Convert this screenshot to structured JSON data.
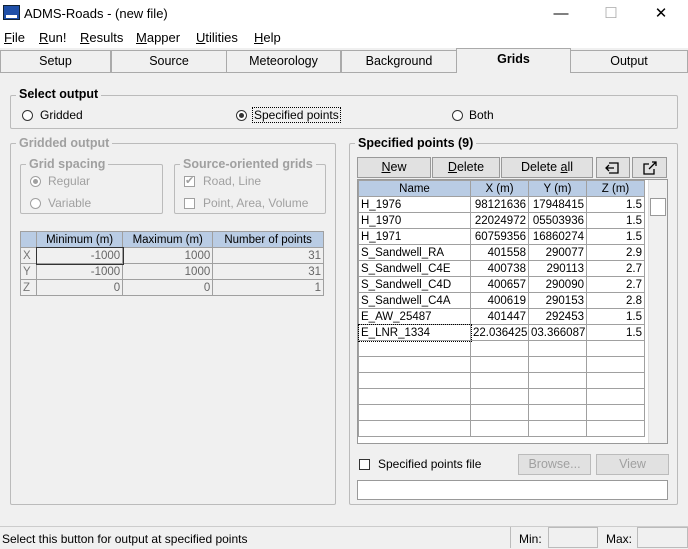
{
  "window": {
    "title": "ADMS-Roads - (new file)",
    "minimize": "—",
    "maximize": "☐",
    "close": "✕"
  },
  "menu": [
    {
      "pre": "",
      "u": "F",
      "post": "ile"
    },
    {
      "pre": "",
      "u": "R",
      "post": "un!"
    },
    {
      "pre": "",
      "u": "R",
      "post": "esults"
    },
    {
      "pre": "",
      "u": "M",
      "post": "apper"
    },
    {
      "pre": "",
      "u": "U",
      "post": "tilities"
    },
    {
      "pre": "",
      "u": "H",
      "post": "elp"
    }
  ],
  "tabs": [
    "Setup",
    "Source",
    "Meteorology",
    "Background",
    "Grids",
    "Output"
  ],
  "select_output": {
    "label": "Select output",
    "options": [
      "Gridded",
      "Specified points",
      "Both"
    ],
    "selected": "Specified points"
  },
  "gridded": {
    "label": "Gridded output",
    "spacing": {
      "label": "Grid spacing",
      "options": [
        "Regular",
        "Variable"
      ],
      "selected": "Regular"
    },
    "source_oriented": {
      "label": "Source-oriented grids",
      "options": [
        {
          "label": "Road, Line",
          "checked": true
        },
        {
          "label": "Point, Area, Volume",
          "checked": false
        }
      ]
    },
    "table": {
      "headers": [
        "",
        "Minimum (m)",
        "Maximum (m)",
        "Number of points"
      ],
      "rows": [
        [
          "X",
          "-1000",
          "1000",
          "31"
        ],
        [
          "Y",
          "-1000",
          "1000",
          "31"
        ],
        [
          "Z",
          "0",
          "0",
          "1"
        ]
      ]
    }
  },
  "specified": {
    "label": "Specified points (9)",
    "buttons": {
      "new": "New",
      "delete": "Delete",
      "delete_all": "Delete all"
    },
    "headers": [
      "Name",
      "X (m)",
      "Y (m)",
      "Z (m)"
    ],
    "rows": [
      [
        "H_1976",
        "98121636",
        "17948415",
        "1.5"
      ],
      [
        "H_1970",
        "22024972",
        "05503936",
        "1.5"
      ],
      [
        "H_1971",
        "60759356",
        "16860274",
        "1.5"
      ],
      [
        "S_Sandwell_RA",
        "401558",
        "290077",
        "2.9"
      ],
      [
        "S_Sandwell_C4E",
        "400738",
        "290113",
        "2.7"
      ],
      [
        "S_Sandwell_C4D",
        "400657",
        "290090",
        "2.7"
      ],
      [
        "S_Sandwell_C4A",
        "400619",
        "290153",
        "2.8"
      ],
      [
        "E_AW_25487",
        "401447",
        "292453",
        "1.5"
      ],
      [
        "E_LNR_1334",
        "22.036425",
        "03.366087",
        "1.5"
      ]
    ],
    "file_checkbox": "Specified points file",
    "browse": "Browse...",
    "view": "View",
    "file_path": ""
  },
  "status": {
    "text": "Select this button for output at specified points",
    "min_label": "Min:",
    "max_label": "Max:",
    "min": "",
    "max": ""
  }
}
